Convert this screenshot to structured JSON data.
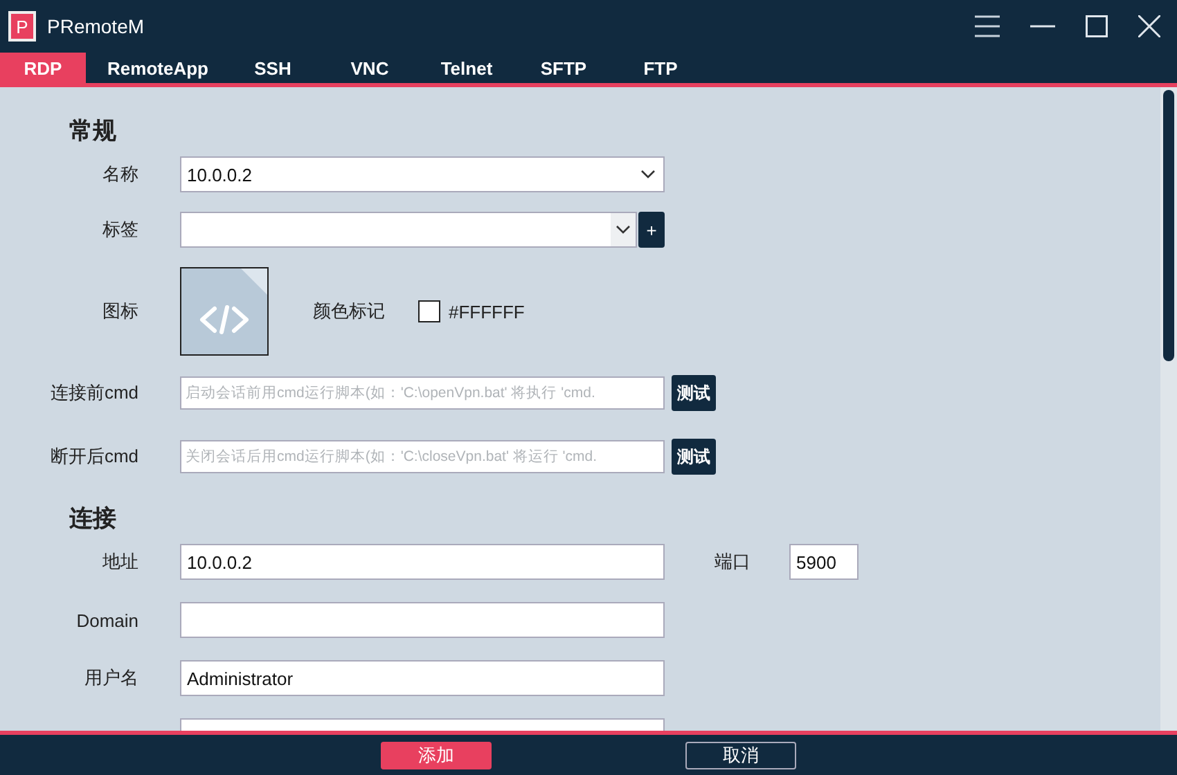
{
  "window": {
    "title": "PRemoteM",
    "logo_letter": "P"
  },
  "tabs": [
    {
      "label": "RDP",
      "selected": true
    },
    {
      "label": "RemoteApp",
      "selected": false
    },
    {
      "label": "SSH",
      "selected": false
    },
    {
      "label": "VNC",
      "selected": false
    },
    {
      "label": "Telnet",
      "selected": false
    },
    {
      "label": "SFTP",
      "selected": false
    },
    {
      "label": "FTP",
      "selected": false
    }
  ],
  "sections": [
    {
      "heading": "常规",
      "fields": [
        {
          "kind": "dropdown",
          "label": "名称",
          "value": "10.0.0.2"
        },
        {
          "kind": "tag-select",
          "label": "标签",
          "button": "+"
        },
        {
          "kind": "icon-picker",
          "label": "图标",
          "color_label": "颜色标记",
          "color": "#ffffff",
          "color_value": "#FFFFFF"
        },
        {
          "kind": "command",
          "label": "连接前cmd",
          "placeholder": "启动会话前用cmd运行脚本(如：'C:\\openVpn.bat' 将执行 'cmd.",
          "button": "测试"
        },
        {
          "kind": "command",
          "label": "断开后cmd",
          "placeholder": "关闭会话后用cmd运行脚本(如：'C:\\closeVpn.bat' 将运行 'cmd.",
          "button": "测试"
        }
      ]
    },
    {
      "heading": "连接",
      "fields": [
        {
          "kind": "text-port",
          "label": "地址",
          "value": "10.0.0.2",
          "port_label": "端口",
          "port_value": "5900"
        },
        {
          "kind": "text",
          "label": "Domain"
        },
        {
          "kind": "text",
          "label": "用户名",
          "value": "Administrator"
        },
        {
          "kind": "text"
        }
      ]
    }
  ],
  "footer": {
    "buttons": [
      {
        "label": "添加",
        "kind": "primary"
      },
      {
        "label": "取消",
        "kind": "secondary"
      }
    ]
  }
}
